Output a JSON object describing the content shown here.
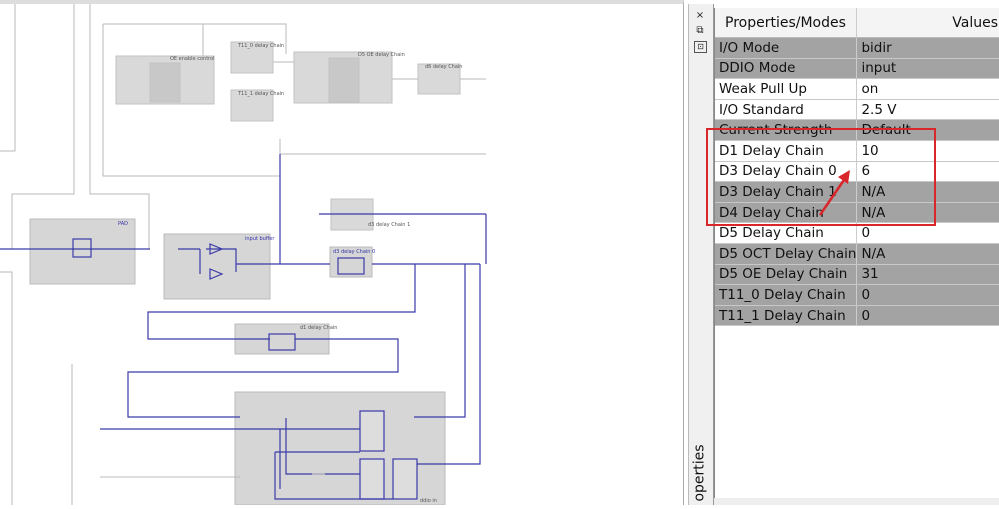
{
  "schematic": {
    "blocks": {
      "pad": "PAD",
      "input_buffer": "input buffer",
      "ddio_in": "ddio in",
      "d3_chain_0": "d3 delay Chain 0",
      "d3_chain_1": "d3 delay Chain 1",
      "d1_chain": "d1 delay Chain",
      "oe_enable": "OE enable control",
      "t11_0": "T11_0 delay Chain",
      "t11_1": "T11_1 delay Chain",
      "d5_oe": "D5 OE delay Chain",
      "d6": "d6 delay Chain"
    }
  },
  "sidebar": {
    "close_icon": "×",
    "float_icon": "⧉",
    "pin_icon": "⊡",
    "tab_label": "operties"
  },
  "properties": {
    "headers": [
      "Properties/Modes",
      "Values"
    ],
    "rows": [
      {
        "name": "I/O Mode",
        "value": "bidir",
        "shaded": true
      },
      {
        "name": "DDIO Mode",
        "value": "input",
        "shaded": true
      },
      {
        "name": "Weak Pull Up",
        "value": "on",
        "shaded": false
      },
      {
        "name": "I/O Standard",
        "value": "2.5 V",
        "shaded": false
      },
      {
        "name": "Current Strength",
        "value": "Default",
        "shaded": true
      },
      {
        "name": "D1 Delay Chain",
        "value": "10",
        "shaded": false
      },
      {
        "name": "D3 Delay Chain 0",
        "value": "6",
        "shaded": false
      },
      {
        "name": "D3 Delay Chain 1",
        "value": "N/A",
        "shaded": true
      },
      {
        "name": "D4 Delay Chain",
        "value": "N/A",
        "shaded": true
      },
      {
        "name": "D5 Delay Chain",
        "value": "0",
        "shaded": false
      },
      {
        "name": "D5 OCT Delay Chain",
        "value": "N/A",
        "shaded": true
      },
      {
        "name": "D5 OE Delay Chain",
        "value": "31",
        "shaded": true
      },
      {
        "name": "T11_0 Delay Chain",
        "value": "0",
        "shaded": true
      },
      {
        "name": "T11_1 Delay Chain",
        "value": "0",
        "shaded": true
      }
    ]
  },
  "colors": {
    "highlight": "#d9262b",
    "wire": "#3a3aa8",
    "block": "#d6d6d6"
  }
}
